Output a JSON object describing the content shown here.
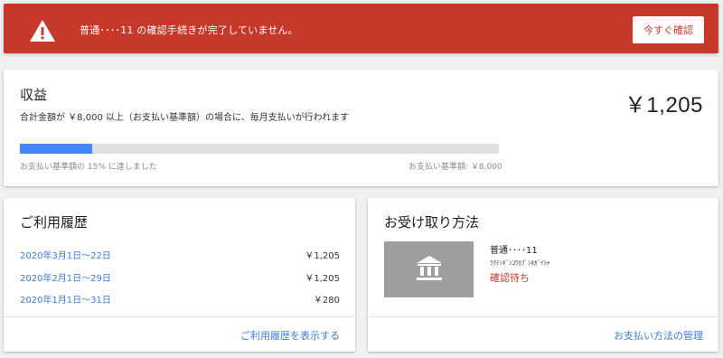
{
  "alert": {
    "message": "普通････11 の確認手続きが完了していません。",
    "button_label": "今すぐ確認",
    "icon": "warning-icon"
  },
  "earnings": {
    "title": "収益",
    "subtitle": "合計金額が ￥8,000 以上（お支払い基準額）の場合に、毎月支払いが行われます",
    "amount": "￥1,205",
    "progress_percent": 15,
    "progress_label": "お支払い基準額の 15% に達しました",
    "threshold_label": "お支払い基準額: ￥8,000"
  },
  "history": {
    "title": "ご利用履歴",
    "rows": [
      {
        "period": "2020年3月1日〜22日",
        "amount": "￥1,205"
      },
      {
        "period": "2020年2月1日〜29日",
        "amount": "￥1,205"
      },
      {
        "period": "2020年1月1日〜31日",
        "amount": "￥280"
      }
    ],
    "link_label": "ご利用履歴を表示する"
  },
  "payment": {
    "title": "お受け取り方法",
    "account_name": "普通････11",
    "bank_name": "ﾗｸﾃﾝｷﾞﾝｺｳｶﾌﾞｼｷｶﾞｲｼｬ",
    "status": "確認待ち",
    "link_label": "お支払い方法の管理",
    "icon": "bank-icon"
  },
  "colors": {
    "alert_red": "#c5382a",
    "link_blue": "#3b7de0",
    "progress_blue": "#4285f4",
    "progress_track": "#e0e0e0",
    "tile_gray": "#9e9e9e"
  }
}
